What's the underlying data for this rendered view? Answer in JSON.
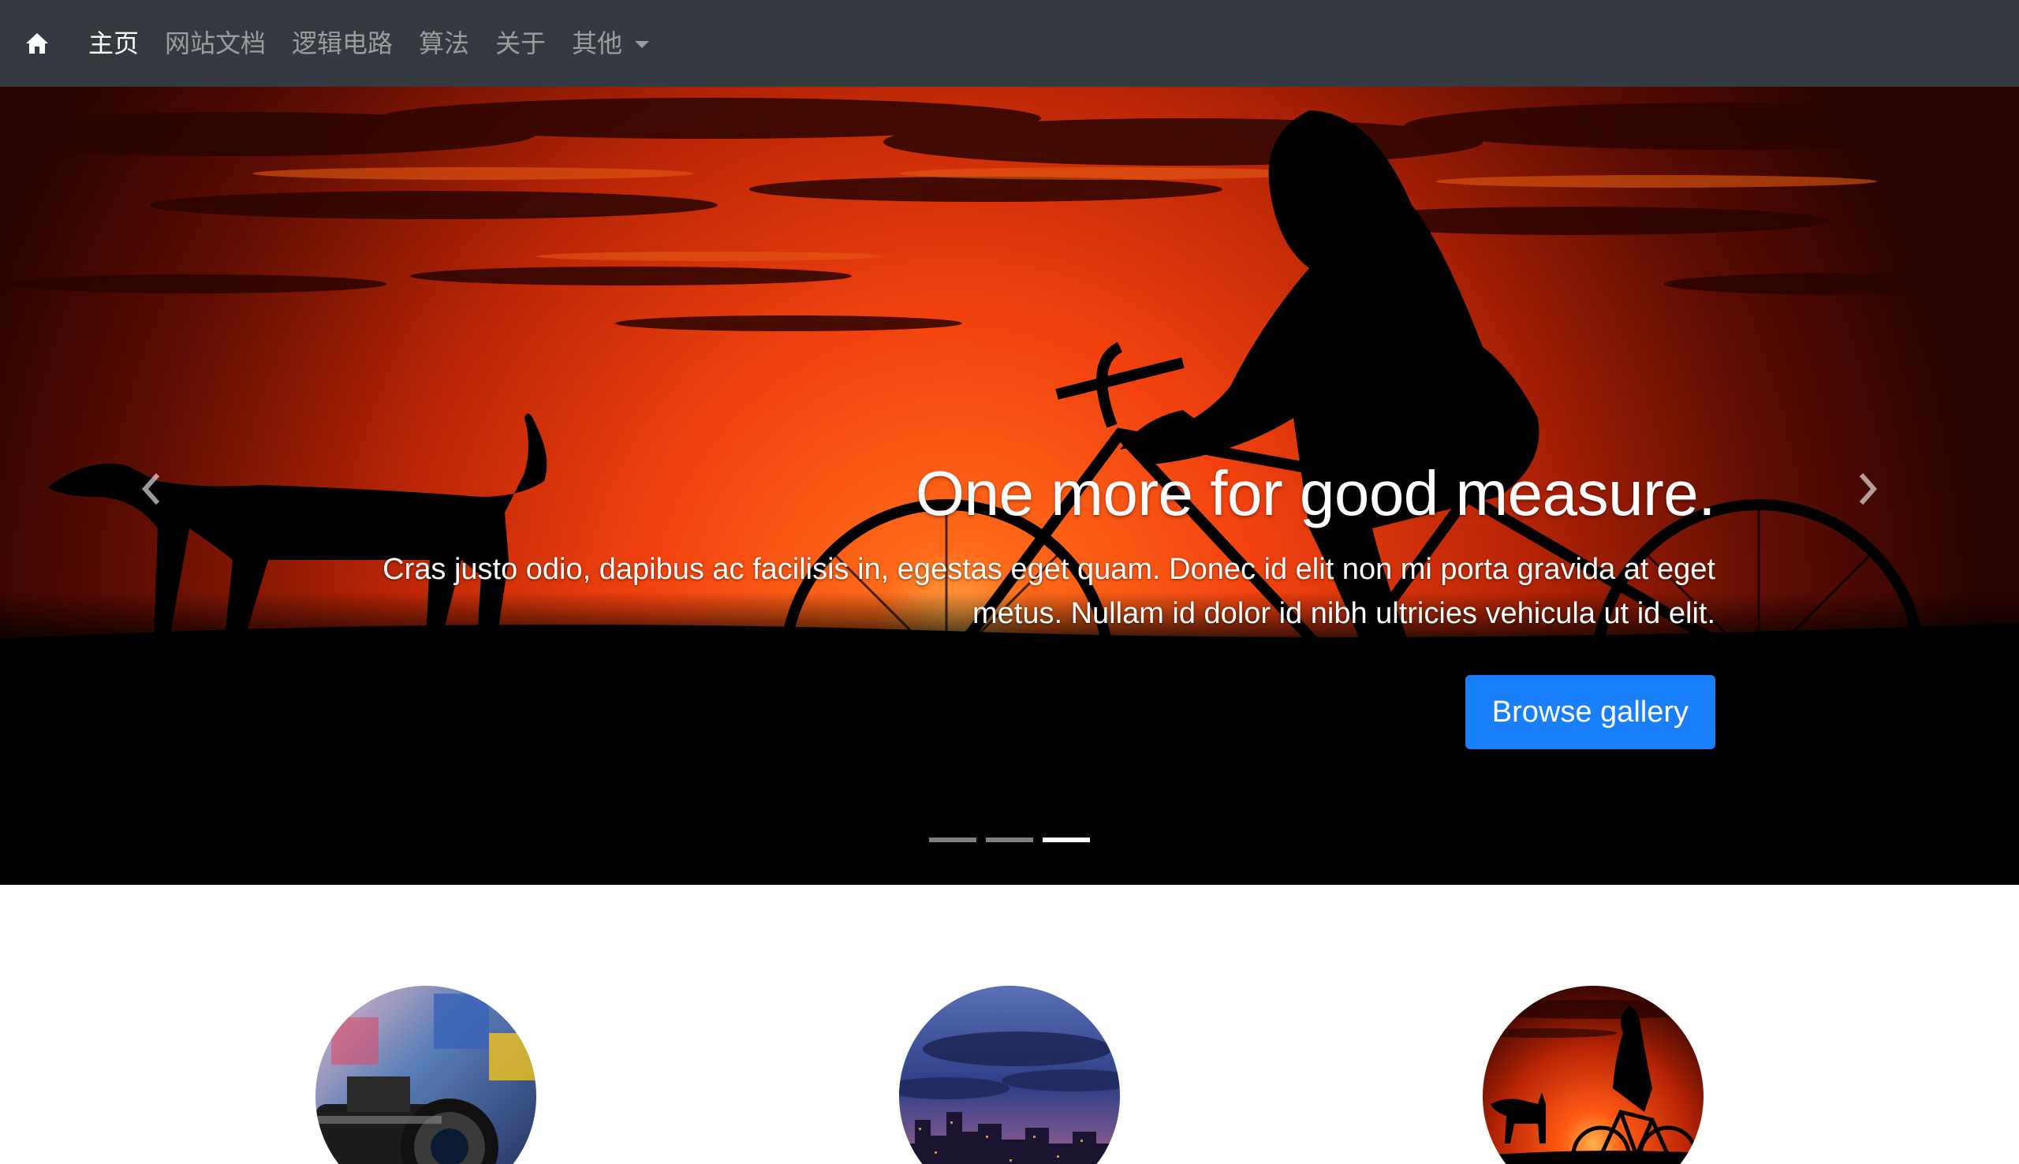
{
  "navbar": {
    "home_icon": "home-icon",
    "items": [
      {
        "label": "主页",
        "active": true
      },
      {
        "label": "网站文档",
        "active": false
      },
      {
        "label": "逻辑电路",
        "active": false
      },
      {
        "label": "算法",
        "active": false
      },
      {
        "label": "关于",
        "active": false
      },
      {
        "label": "其他",
        "active": false,
        "dropdown": true
      }
    ]
  },
  "carousel": {
    "caption": {
      "title": "One more for good measure.",
      "text": "Cras justo odio, dapibus ac facilisis in, egestas eget quam. Donec id elit non mi porta gravida at eget metus. Nullam id dolor id nibh ultricies vehicula ut id elit.",
      "button_label": "Browse gallery"
    },
    "slide_count": 3,
    "active_slide": 3,
    "prev_icon": "chevron-left-icon",
    "next_icon": "chevron-right-icon"
  },
  "colors": {
    "navbar_bg": "#343a40",
    "primary": "#1a7ffb",
    "sunset_orange": "#ff4a12"
  }
}
